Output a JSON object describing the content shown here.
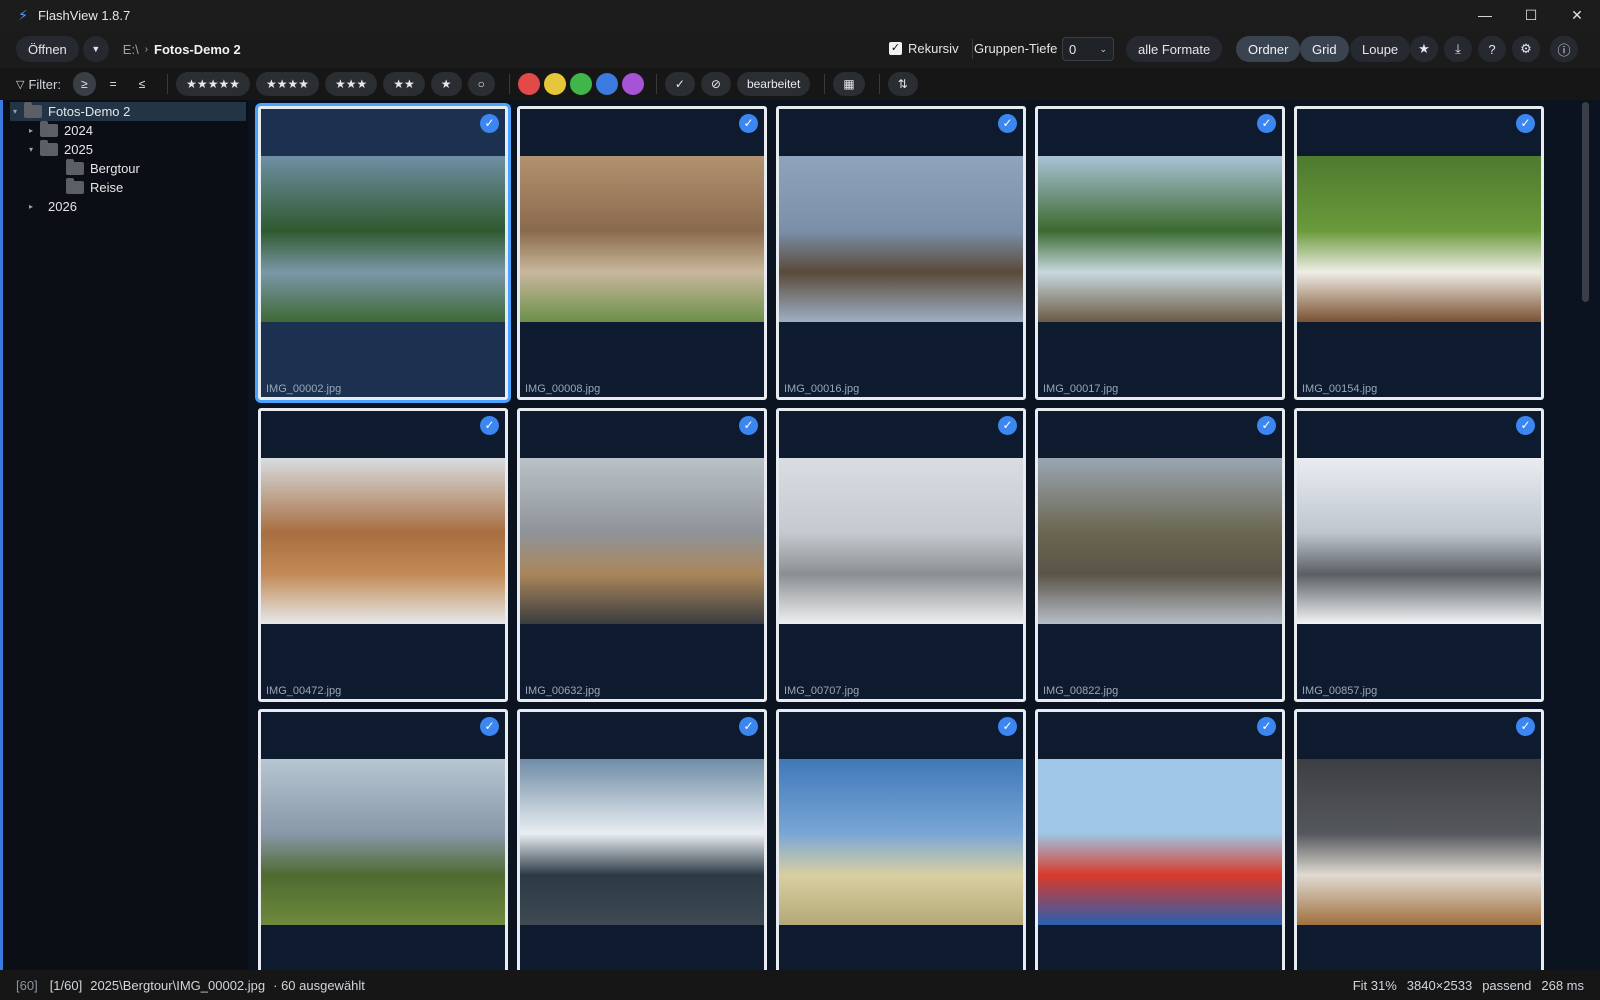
{
  "window": {
    "title": "FlashView 1.8.7",
    "controls": [
      "minimize-icon",
      "maximize-icon",
      "close-icon"
    ]
  },
  "toolbar": {
    "open_label": "Öffnen",
    "breadcrumb": [
      "E:\\",
      "Fotos-Demo 2"
    ],
    "recursive_label": "Rekursiv",
    "recursive_checked": true,
    "group_depth_label": "Gruppen-Tiefe",
    "group_depth_value": "0",
    "formats_label": "alle Formate",
    "view_modes": [
      "Ordner",
      "Grid",
      "Loupe"
    ],
    "active_views": [
      "Ordner",
      "Grid"
    ]
  },
  "filter": {
    "label": "Filter:",
    "operators": [
      "≥",
      "=",
      "≤"
    ],
    "active_operator": "≥",
    "stars": [
      "★★★★★",
      "★★★★",
      "★★★",
      "★★",
      "★",
      "○"
    ],
    "colors": [
      "#e24a4a",
      "#e6c63a",
      "#3fb54a",
      "#3b7be0",
      "#a653d6"
    ],
    "edited_label": "bearbeitet"
  },
  "tree": [
    {
      "label": "Fotos-Demo 2",
      "level": 0,
      "expanded": true,
      "selected": true
    },
    {
      "label": "2024",
      "level": 1,
      "expanded": false
    },
    {
      "label": "2025",
      "level": 1,
      "expanded": true
    },
    {
      "label": "Bergtour",
      "level": 2
    },
    {
      "label": "Reise",
      "level": 2
    },
    {
      "label": "2026",
      "level": 1,
      "expanded": false
    }
  ],
  "thumbnails": [
    {
      "name": "IMG_00002.jpg",
      "selected": true,
      "checked": true,
      "colors": [
        "#6f8fa5",
        "#2f5a2f",
        "#7b97a8",
        "#3d6a35"
      ]
    },
    {
      "name": "IMG_00008.jpg",
      "checked": true,
      "colors": [
        "#b19270",
        "#8a6a4c",
        "#c9b79d",
        "#6c8f4a"
      ]
    },
    {
      "name": "IMG_00016.jpg",
      "checked": true,
      "colors": [
        "#8ea4bd",
        "#7a90a8",
        "#5a4a3a",
        "#9db0c4"
      ]
    },
    {
      "name": "IMG_00017.jpg",
      "checked": true,
      "colors": [
        "#a9c2d6",
        "#3b6a2f",
        "#c8d8df",
        "#6b5a44"
      ]
    },
    {
      "name": "IMG_00154.jpg",
      "checked": true,
      "colors": [
        "#4d7a2f",
        "#6a9a3a",
        "#f0ede6",
        "#7a5030"
      ]
    },
    {
      "name": "IMG_00472.jpg",
      "checked": true,
      "colors": [
        "#d7dde0",
        "#a86e40",
        "#c38a56",
        "#e6e9ea"
      ]
    },
    {
      "name": "IMG_00632.jpg",
      "checked": true,
      "colors": [
        "#b9c2c8",
        "#8f9399",
        "#a9865a",
        "#3a3d40"
      ]
    },
    {
      "name": "IMG_00707.jpg",
      "checked": true,
      "colors": [
        "#d9dde2",
        "#c5cad0",
        "#8c8f92",
        "#eef0f2"
      ]
    },
    {
      "name": "IMG_00822.jpg",
      "checked": true,
      "colors": [
        "#9aa6b2",
        "#6a6650",
        "#5a5348",
        "#b7bfc7"
      ]
    },
    {
      "name": "IMG_00857.jpg",
      "checked": true,
      "colors": [
        "#e9edf1",
        "#bfc6cf",
        "#5b5f63",
        "#f3f5f7"
      ]
    },
    {
      "name": "",
      "checked": true,
      "colors": [
        "#b7c6d2",
        "#8898a8",
        "#4f6a30",
        "#6e8a3c"
      ]
    },
    {
      "name": "",
      "checked": true,
      "colors": [
        "#6f8ca6",
        "#e9eef2",
        "#2c3a45",
        "#3f4a52"
      ]
    },
    {
      "name": "",
      "checked": true,
      "colors": [
        "#3f78b8",
        "#7aa6d6",
        "#d8cfa0",
        "#b5a878"
      ]
    },
    {
      "name": "",
      "checked": true,
      "colors": [
        "#9fc6e6",
        "#9fc6e6",
        "#d83a2a",
        "#2a5fb0"
      ]
    },
    {
      "name": "",
      "checked": true,
      "colors": [
        "#3c3e42",
        "#55585d",
        "#e0dad2",
        "#a0703e"
      ]
    }
  ],
  "status": {
    "count": "[60]",
    "position": "[1/60]",
    "path": "2025\\Bergtour\\IMG_00002.jpg",
    "selected": "· 60 ausgewählt",
    "fit": "Fit 31%",
    "resolution": "3840×2533",
    "mode": "passend",
    "time": "268 ms"
  }
}
